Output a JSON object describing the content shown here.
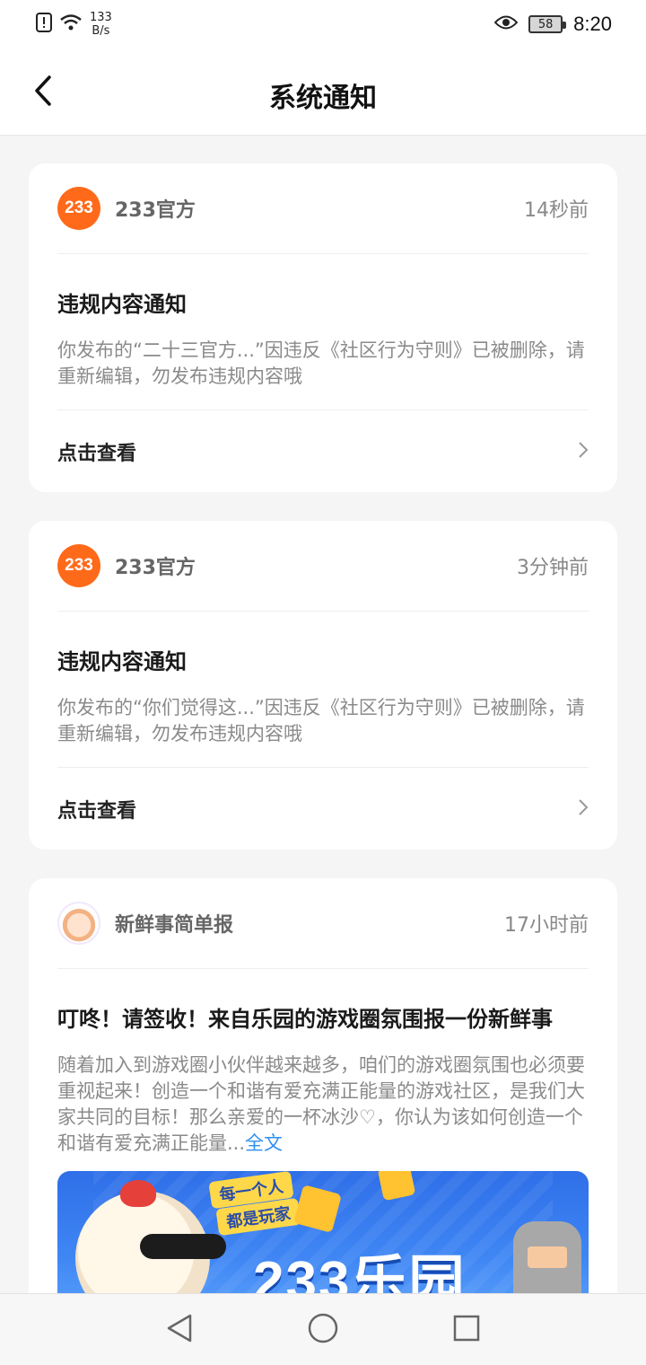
{
  "status_bar": {
    "speed_value": "133",
    "speed_unit": "B/s",
    "battery": "58",
    "time": "8:20"
  },
  "app_bar": {
    "title": "系统通知"
  },
  "notifications": [
    {
      "author": "233官方",
      "time": "14秒前",
      "title": "违规内容通知",
      "body": "你发布的“二十三官方...”因违反《社区行为守则》已被删除，请重新编辑，勿发布违规内容哦",
      "action_label": "点击查看"
    },
    {
      "author": "233官方",
      "time": "3分钟前",
      "title": "违规内容通知",
      "body": "你发布的“你们觉得这...”因违反《社区行为守则》已被删除，请重新编辑，勿发布违规内容哦",
      "action_label": "点击查看"
    },
    {
      "author": "新鲜事简单报",
      "time": "17小时前",
      "title": "叮咚！请签收！来自乐园的游戏圈氛围报一份新鲜事",
      "body": "随着加入到游戏圈小伙伴越来越多，咱们的游戏圈氛围也必须要重视起来！创造一个和谐有爱充满正能量的游戏社区，是我们大家共同的目标！那么亲爱的一杯冰沙♡，你认为该如何创造一个和谐有爱充满正能量...",
      "more_label": "全文",
      "banner": {
        "tag_line_1": "每一个人",
        "tag_line_2": "都是玩家",
        "big_text": "233乐园"
      }
    }
  ],
  "brand_logo_text": "233",
  "colors": {
    "brand_orange": "#ff6a1a",
    "link_blue": "#2e8ff0",
    "background": "#f5f5f5"
  },
  "icons": [
    "back-arrow-icon",
    "chevron-right-icon",
    "nav-back-icon",
    "nav-home-icon",
    "nav-recents-icon",
    "wifi-icon",
    "sim-alert-icon",
    "eye-icon"
  ]
}
